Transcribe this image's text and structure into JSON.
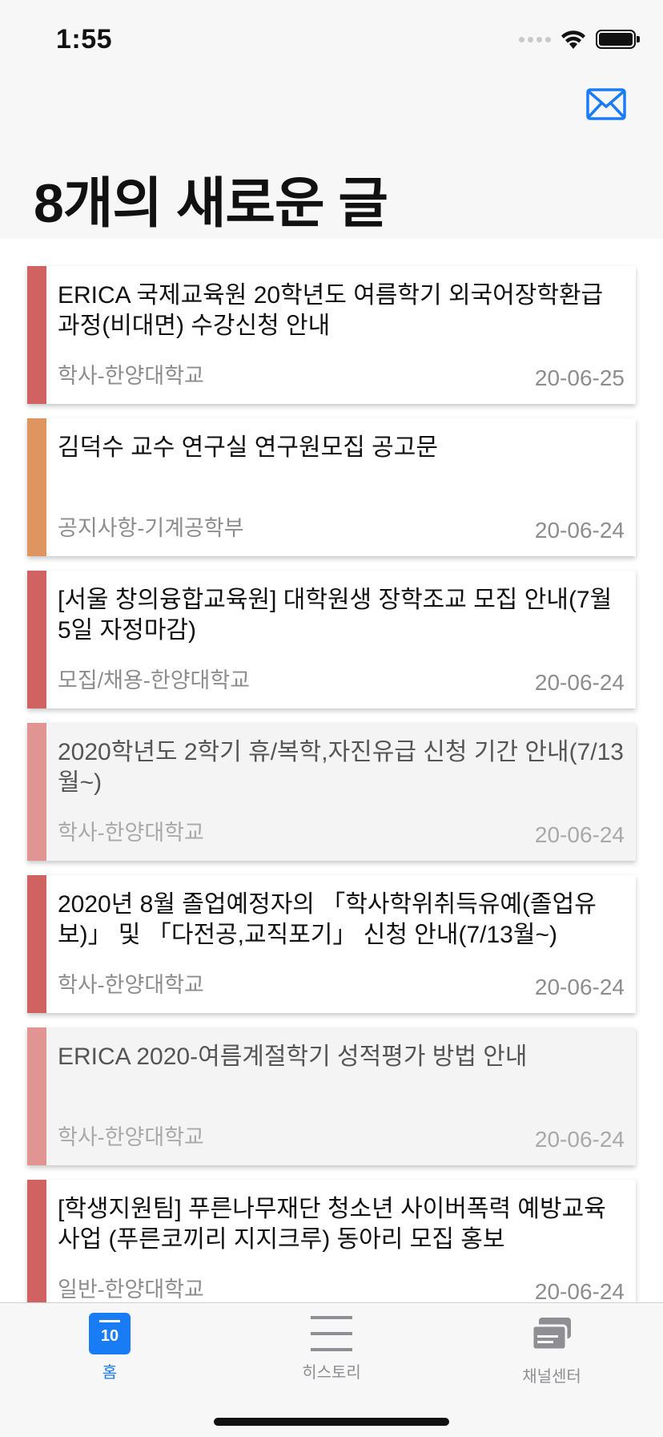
{
  "status_bar": {
    "time": "1:55"
  },
  "header": {
    "title": "8개의 새로운 글"
  },
  "colors": {
    "accent": "#1a7cf5",
    "bar_red": "#d06361",
    "bar_orange": "#df9560",
    "bar_red_faded": "#e19593"
  },
  "posts": [
    {
      "title": "ERICA 국제교육원 20학년도 여름학기 외국어장학환급과정(비대면) 수강신청 안내",
      "source": "학사-한양대학교",
      "date": "20-06-25"
    },
    {
      "title": "김덕수 교수 연구실 연구원모집 공고문",
      "source": "공지사항-기계공학부",
      "date": "20-06-24"
    },
    {
      "title": "[서울 창의융합교육원] 대학원생 장학조교 모집 안내(7월 5일 자정마감)",
      "source": "모집/채용-한양대학교",
      "date": "20-06-24"
    },
    {
      "title": "2020학년도 2학기 휴/복학,자진유급 신청 기간 안내(7/13월~)",
      "source": "학사-한양대학교",
      "date": "20-06-24"
    },
    {
      "title": "2020년 8월 졸업예정자의 「학사학위취득유예(졸업유보)」 및 「다전공,교직포기」 신청 안내(7/13월~)",
      "source": "학사-한양대학교",
      "date": "20-06-24"
    },
    {
      "title": "ERICA 2020-여름계절학기 성적평가 방법 안내",
      "source": "학사-한양대학교",
      "date": "20-06-24"
    },
    {
      "title": "[학생지원팀] 푸른나무재단 청소년 사이버폭력 예방교육사업 (푸른코끼리 지지크루) 동아리 모집 홍보",
      "source": "일반-한양대학교",
      "date": "20-06-24"
    }
  ],
  "tabbar": {
    "home_label": "홈",
    "home_icon_number": "10",
    "history_label": "히스토리",
    "channel_label": "채널센터"
  }
}
